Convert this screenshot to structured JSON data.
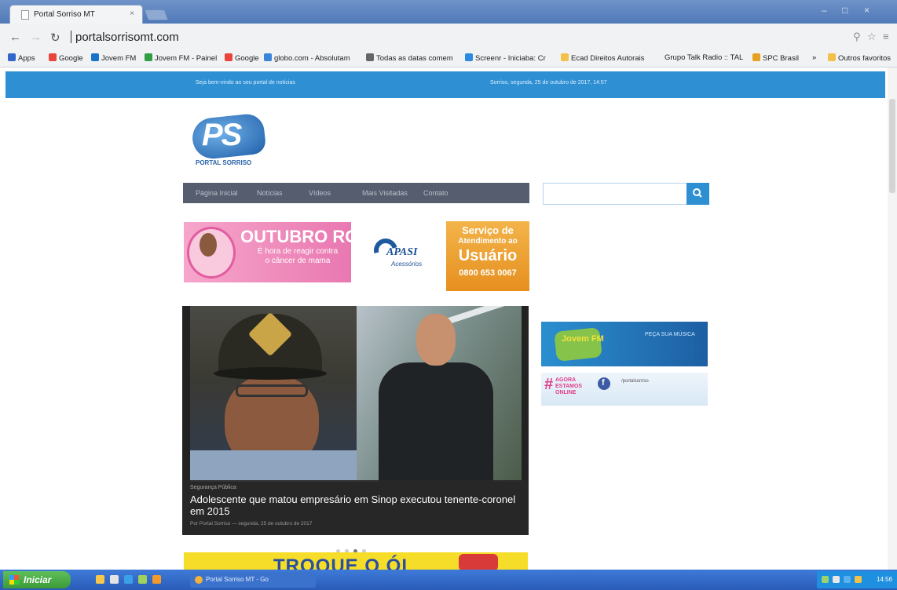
{
  "browser": {
    "tab_title": "Portal Sorriso MT",
    "tab_close": "×",
    "url": "portalsorrisomt.com",
    "window_controls": [
      "–",
      "□",
      "×"
    ],
    "bookmarks": [
      {
        "label": "Apps",
        "icon": "apps-grid-icon",
        "color": "#3366cc"
      },
      {
        "label": "Google",
        "icon": "google-icon",
        "color": "#e8453c"
      },
      {
        "label": "Jovem FM",
        "icon": "radio-icon",
        "color": "#1a73c9"
      },
      {
        "label": "Jovem FM - Painel",
        "icon": "drive-icon",
        "color": "#2f9e44"
      },
      {
        "label": "Google",
        "icon": "google-icon",
        "color": "#e8453c"
      },
      {
        "label": "globo.com - Absolutam",
        "icon": "globo-icon",
        "color": "#3a86d8"
      },
      {
        "label": "Todas as datas comem",
        "icon": "link-icon",
        "color": "#666666"
      },
      {
        "label": "Screenr - Iniciaba: Cr",
        "icon": "screenr-icon",
        "color": "#2c8be0"
      },
      {
        "label": "Ecad Direitos Autorais",
        "icon": "folder-icon",
        "color": "#f2c14a"
      },
      {
        "label": "Grupo Talk Radio :: TAL",
        "icon": "radio-icon",
        "color": "#888888"
      },
      {
        "label": "SPC Brasil",
        "icon": "spc-icon",
        "color": "#e8a020"
      },
      {
        "label": "»",
        "icon": "",
        "color": ""
      },
      {
        "label": "Outros favoritos",
        "icon": "folder-icon",
        "color": "#f2c14a"
      }
    ]
  },
  "page": {
    "topbar": {
      "welcome": "Seja bem-vindo ao seu portal de notícias",
      "date": "Sorriso, segunda, 25 de outubro de 2017, 14:57"
    },
    "logo": {
      "mark": "PS",
      "subtitle": "PORTAL SORRISO"
    },
    "nav": [
      "Página Inicial",
      "Notícias",
      "Vídeos",
      "Mais Visitadas",
      "Contato"
    ],
    "search": {
      "placeholder": "",
      "button_icon": "search-icon"
    },
    "banners": {
      "outubro_rosa": {
        "title": "OUTUBRO ROSA",
        "subtitle": "É hora de reagir contra o câncer de mama"
      },
      "apasi": {
        "name": "APASI",
        "tagline": "Acessórios"
      },
      "servico": {
        "line1": "Serviço de",
        "line2": "Atendimento ao",
        "line3": "Usuário",
        "phone": "0800 653 0067"
      },
      "troque": {
        "text": "TROQUE O ÓL"
      },
      "radio": {
        "brand": "Jovem FM",
        "text": "PEÇA SUA MÚSICA"
      },
      "online": {
        "hash": "#",
        "text": "AGORA ESTAMOS ONLINE",
        "page": "/portalsorriso"
      }
    },
    "slider": {
      "category": "Segurança Pública",
      "title": "Adolescente que matou empresário em Sinop executou tenente-coronel em 2015",
      "subtitle": "Por Portal Sorriso — segunda, 25 de outubro de 2017",
      "active_slide": 3,
      "total_slides": 5
    }
  },
  "taskbar": {
    "start_label": "Iniciar",
    "task_label": "Portal Sorriso MT - Go",
    "clock": "14:56"
  }
}
